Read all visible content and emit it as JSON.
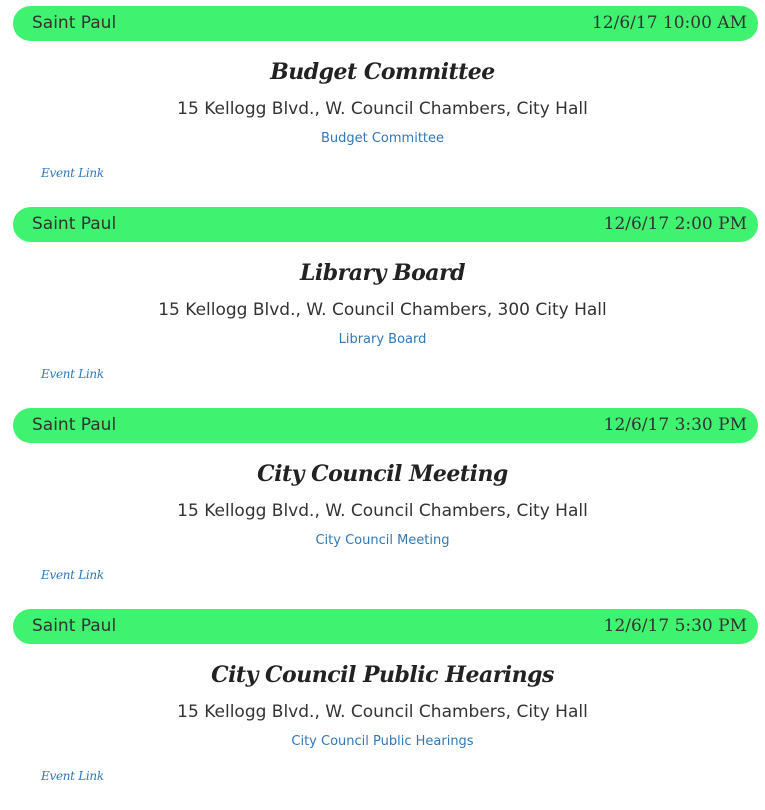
{
  "events": [
    {
      "city": "Saint Paul",
      "datetime": "12/6/17 10:00 AM",
      "title": "Budget Committee",
      "address": "15 Kellogg Blvd., W. Council Chambers, City Hall",
      "name_link": "Budget Committee",
      "event_link": "Event Link"
    },
    {
      "city": "Saint Paul",
      "datetime": "12/6/17 2:00 PM",
      "title": "Library Board",
      "address": "15 Kellogg Blvd., W. Council Chambers, 300 City Hall",
      "name_link": "Library Board",
      "event_link": "Event Link"
    },
    {
      "city": "Saint Paul",
      "datetime": "12/6/17 3:30 PM",
      "title": "City Council Meeting",
      "address": "15 Kellogg Blvd., W. Council Chambers, City Hall",
      "name_link": "City Council Meeting",
      "event_link": "Event Link"
    },
    {
      "city": "Saint Paul",
      "datetime": "12/6/17 5:30 PM",
      "title": "City Council Public Hearings",
      "address": "15 Kellogg Blvd., W. Council Chambers, City Hall",
      "name_link": "City Council Public Hearings",
      "event_link": "Event Link"
    }
  ],
  "colors": {
    "bar": "#3ff26f",
    "link": "#2f78b9",
    "text": "#333333"
  }
}
